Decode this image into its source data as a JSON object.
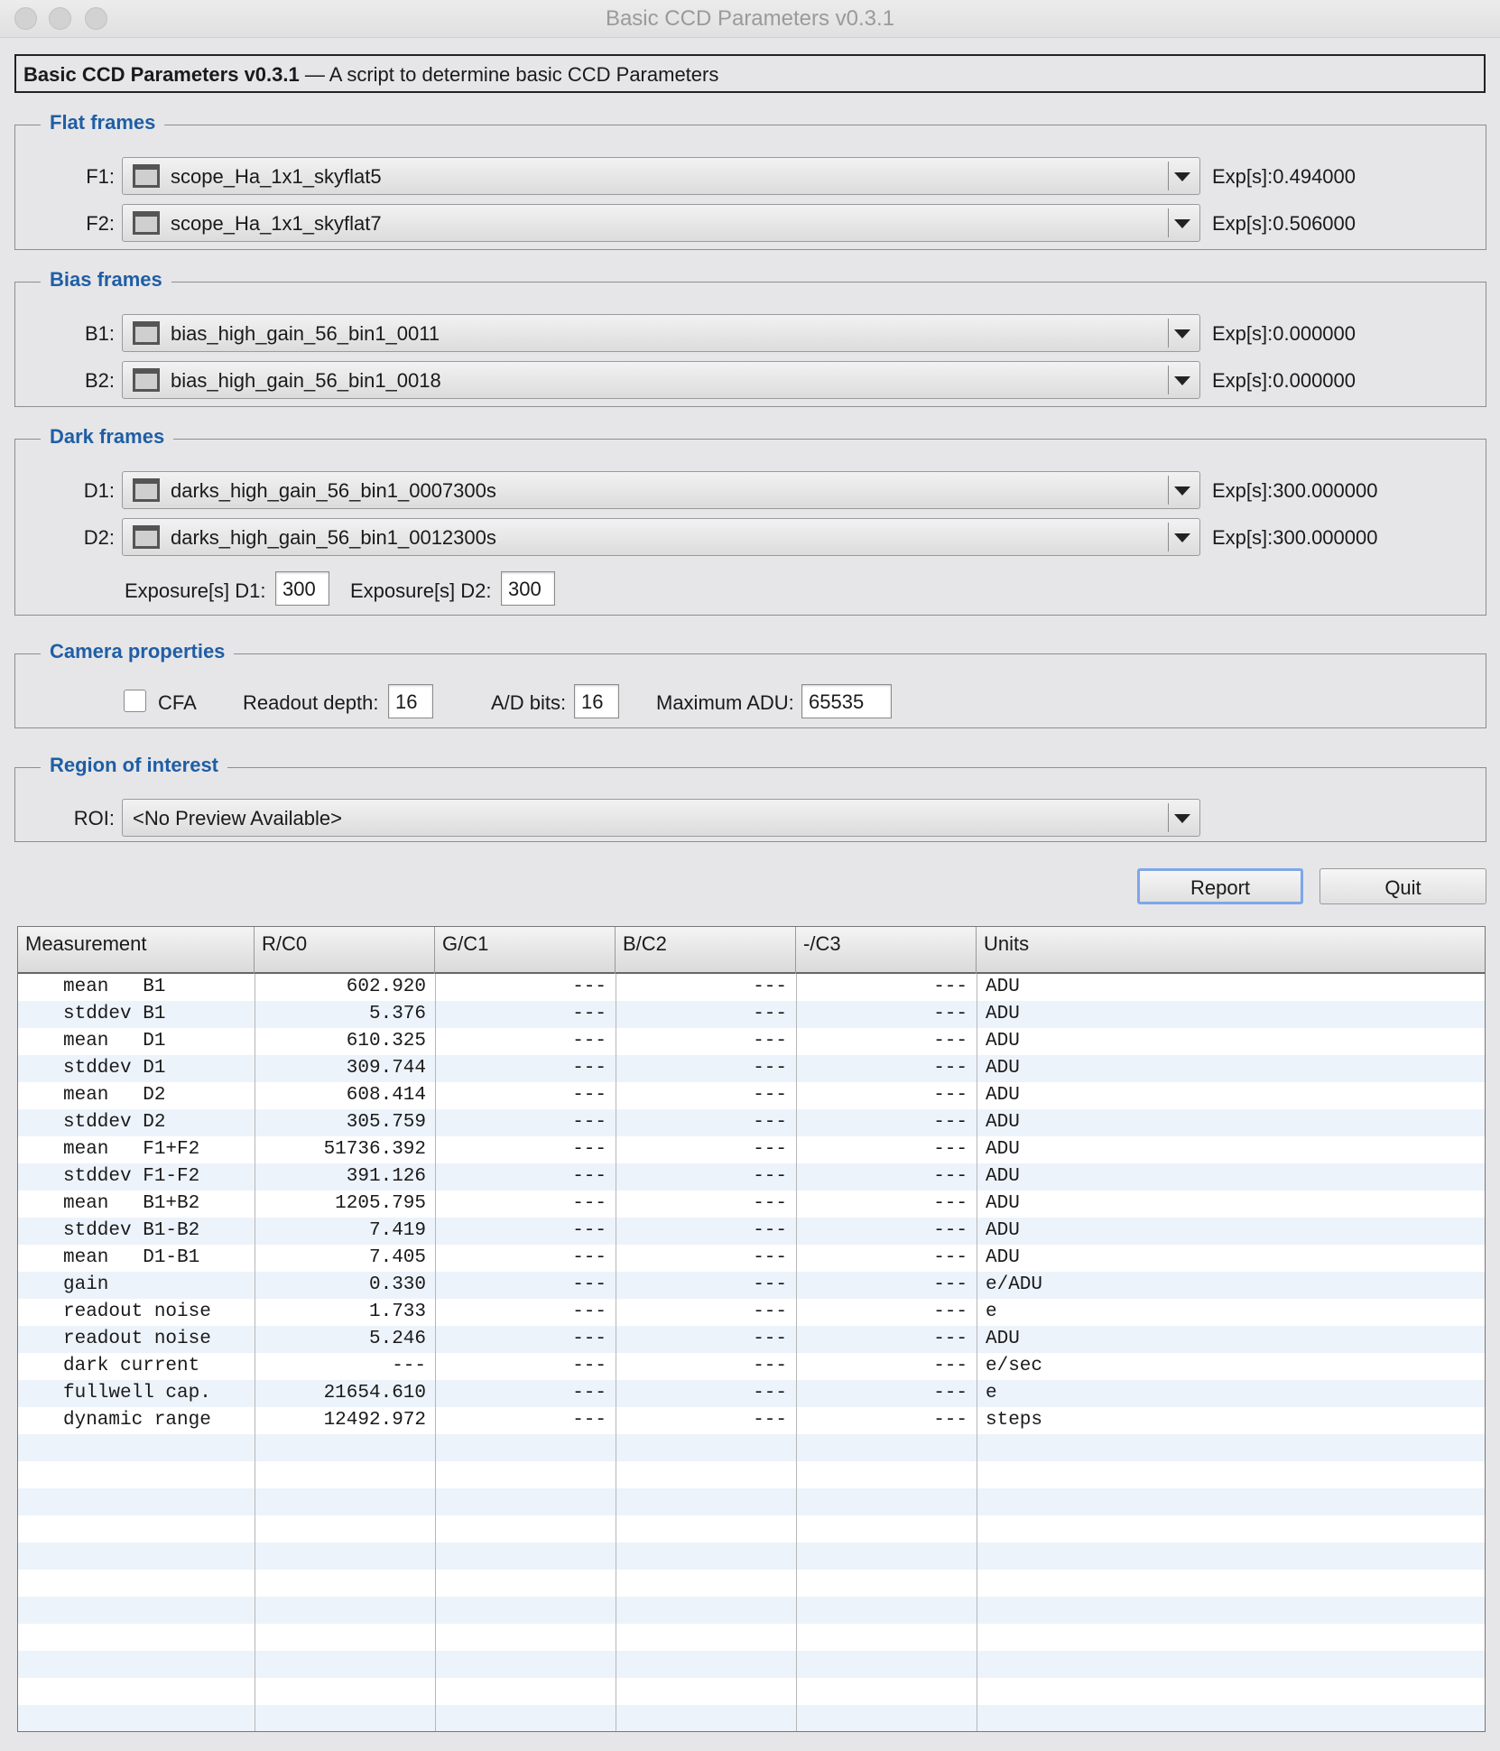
{
  "window": {
    "title": "Basic CCD Parameters v0.3.1"
  },
  "header": {
    "name": "Basic CCD Parameters v0.3.1",
    "desc": "— A script to determine basic CCD Parameters"
  },
  "flat": {
    "title": "Flat frames",
    "f1": {
      "label": "F1:",
      "value": "scope_Ha_1x1_skyflat5",
      "exp": "Exp[s]:0.494000"
    },
    "f2": {
      "label": "F2:",
      "value": "scope_Ha_1x1_skyflat7",
      "exp": "Exp[s]:0.506000"
    }
  },
  "bias": {
    "title": "Bias frames",
    "b1": {
      "label": "B1:",
      "value": "bias_high_gain_56_bin1_0011",
      "exp": "Exp[s]:0.000000"
    },
    "b2": {
      "label": "B2:",
      "value": "bias_high_gain_56_bin1_0018",
      "exp": "Exp[s]:0.000000"
    }
  },
  "dark": {
    "title": "Dark frames",
    "d1": {
      "label": "D1:",
      "value": "darks_high_gain_56_bin1_0007300s",
      "exp": "Exp[s]:300.000000"
    },
    "d2": {
      "label": "D2:",
      "value": "darks_high_gain_56_bin1_0012300s",
      "exp": "Exp[s]:300.000000"
    },
    "exp_d1_label": "Exposure[s] D1:",
    "exp_d1": "300",
    "exp_d2_label": "Exposure[s] D2:",
    "exp_d2": "300"
  },
  "camera": {
    "title": "Camera properties",
    "cfa_label": "CFA",
    "cfa_checked": false,
    "readout_label": "Readout depth:",
    "readout": "16",
    "adbits_label": "A/D bits:",
    "adbits": "16",
    "maxadu_label": "Maximum ADU:",
    "maxadu": "65535"
  },
  "roi": {
    "title": "Region of interest",
    "label": "ROI:",
    "value": "<No Preview Available>"
  },
  "buttons": {
    "report": "Report",
    "quit": "Quit"
  },
  "table": {
    "columns": [
      "Measurement",
      "R/C0",
      "G/C1",
      "B/C2",
      "-/C3",
      "Units"
    ],
    "rows": [
      [
        "mean   B1",
        "602.920",
        "---",
        "---",
        "---",
        "ADU"
      ],
      [
        "stddev B1",
        "5.376",
        "---",
        "---",
        "---",
        "ADU"
      ],
      [
        "mean   D1",
        "610.325",
        "---",
        "---",
        "---",
        "ADU"
      ],
      [
        "stddev D1",
        "309.744",
        "---",
        "---",
        "---",
        "ADU"
      ],
      [
        "mean   D2",
        "608.414",
        "---",
        "---",
        "---",
        "ADU"
      ],
      [
        "stddev D2",
        "305.759",
        "---",
        "---",
        "---",
        "ADU"
      ],
      [
        "mean   F1+F2",
        "51736.392",
        "---",
        "---",
        "---",
        "ADU"
      ],
      [
        "stddev F1-F2",
        "391.126",
        "---",
        "---",
        "---",
        "ADU"
      ],
      [
        "mean   B1+B2",
        "1205.795",
        "---",
        "---",
        "---",
        "ADU"
      ],
      [
        "stddev B1-B2",
        "7.419",
        "---",
        "---",
        "---",
        "ADU"
      ],
      [
        "mean   D1-B1",
        "7.405",
        "---",
        "---",
        "---",
        "ADU"
      ],
      [
        "gain",
        "0.330",
        "---",
        "---",
        "---",
        "e/ADU"
      ],
      [
        "readout noise",
        "1.733",
        "---",
        "---",
        "---",
        "e"
      ],
      [
        "readout noise",
        "5.246",
        "---",
        "---",
        "---",
        "ADU"
      ],
      [
        "dark current",
        "---",
        "---",
        "---",
        "---",
        "e/sec"
      ],
      [
        "fullwell cap.",
        "21654.610",
        "---",
        "---",
        "---",
        "e"
      ],
      [
        "dynamic range",
        "12492.972",
        "---",
        "---",
        "---",
        "steps"
      ]
    ]
  }
}
